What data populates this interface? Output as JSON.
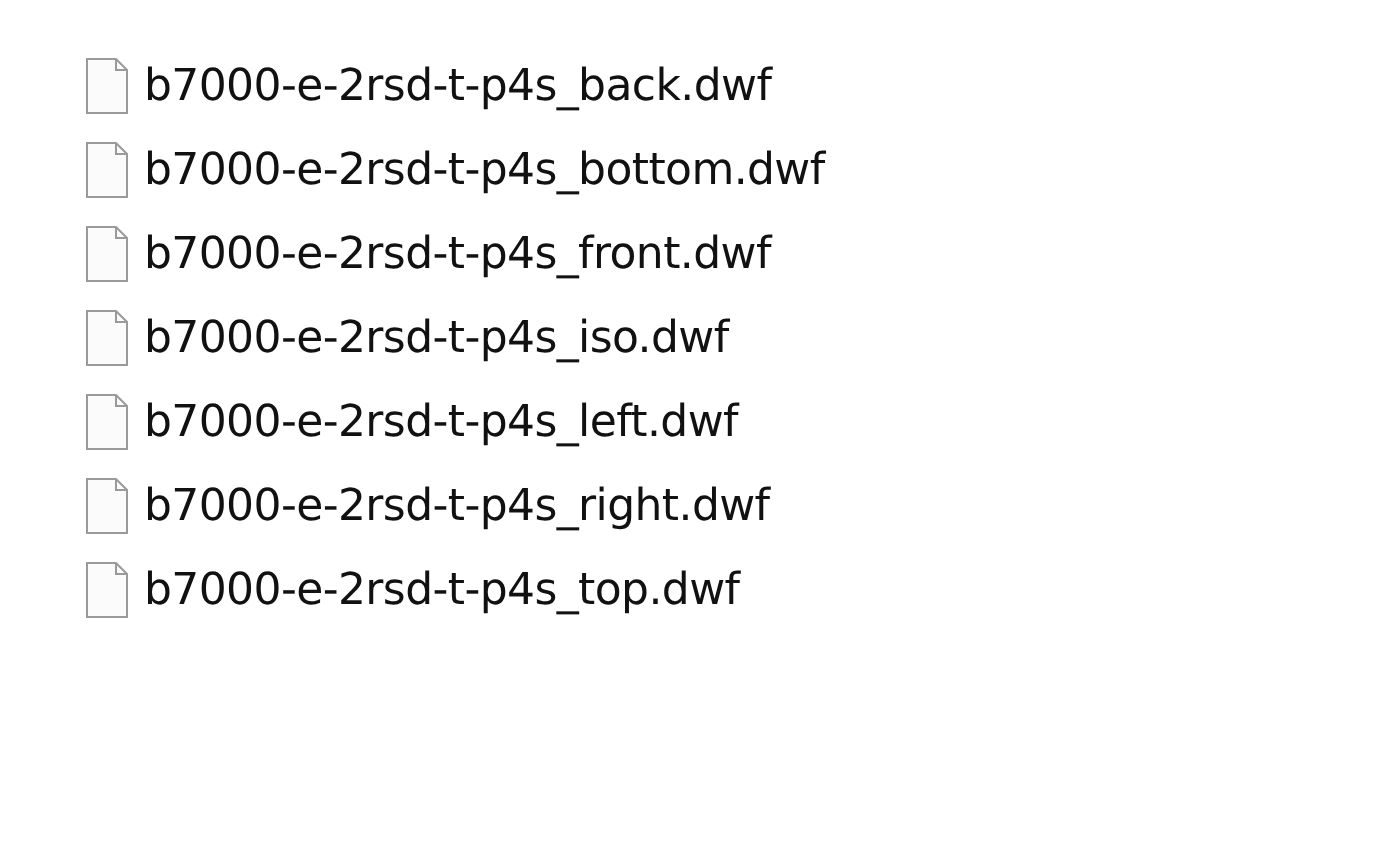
{
  "files": [
    {
      "name": "b7000-e-2rsd-t-p4s_back.dwf"
    },
    {
      "name": "b7000-e-2rsd-t-p4s_bottom.dwf"
    },
    {
      "name": "b7000-e-2rsd-t-p4s_front.dwf"
    },
    {
      "name": "b7000-e-2rsd-t-p4s_iso.dwf"
    },
    {
      "name": "b7000-e-2rsd-t-p4s_left.dwf"
    },
    {
      "name": "b7000-e-2rsd-t-p4s_right.dwf"
    },
    {
      "name": "b7000-e-2rsd-t-p4s_top.dwf"
    }
  ]
}
